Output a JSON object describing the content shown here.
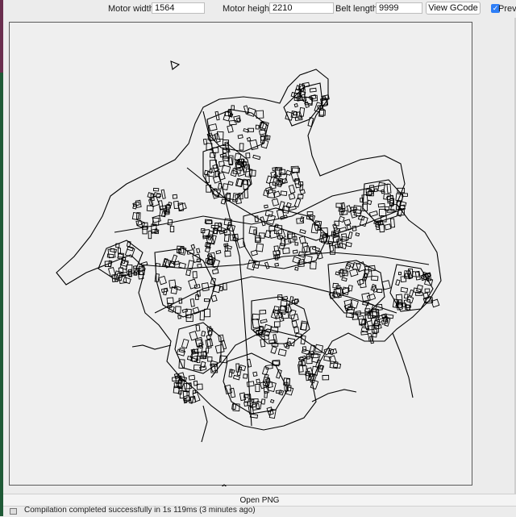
{
  "toolbar": {
    "motor_width_label": "Motor width:",
    "motor_width_value": "1564",
    "motor_height_label": "Motor height:",
    "motor_height_value": "2210",
    "belt_length_label": "Belt length:",
    "belt_length_value": "9999",
    "view_gcode_label": "View GCode",
    "preview_label": "Previ",
    "preview_checked": true
  },
  "canvas": {
    "background": "#efefef",
    "stroke_color": "#000000"
  },
  "footer": {
    "open_png_label": "Open PNG"
  },
  "status": {
    "message": "Compilation completed successfully in 1s 119ms (3 minutes ago)"
  },
  "colors": {
    "window_background": "#ececec",
    "checkbox_accent": "#2e7ef7",
    "left_strip_top": "#6a2e4e",
    "left_strip_bottom": "#1f5a36"
  }
}
